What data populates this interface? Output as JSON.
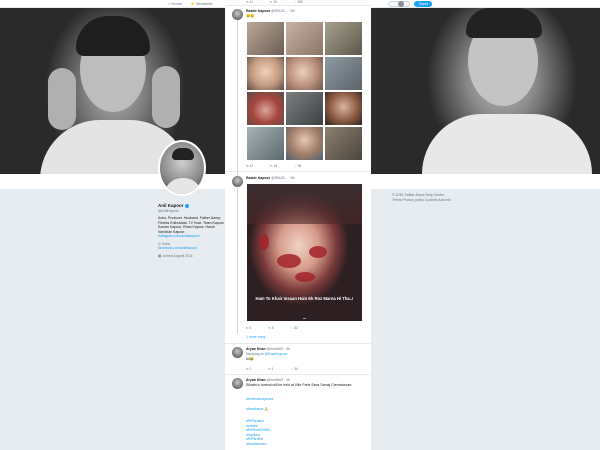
{
  "nav": {
    "home": "⌂ Home",
    "moments": "⚡ Moments",
    "tweet_button": "Tweet"
  },
  "profile": {
    "name": "Anil Kapoor",
    "handle": "@AnilKapoor",
    "bio": "Actor, Producer, Husband, Father &amp; Fitness Enthusiast. TV Host. Team Kapoor. Sonam Kapoor, Rhea Kapoor, Harsh Varrdhan Kapoor.",
    "links": [
      "instagram.com/anilskapoor",
      "facebook.com/anilkapoor"
    ],
    "location": "India",
    "joined": "Joined August 2011"
  },
  "footer": {
    "text": "© 2018 Twitter  About  Help Center  Terms  Privacy policy  Cookies  Ads info"
  },
  "tweets": [
    {
      "name": "Rasbir Kapoor",
      "handle": "@IRAJB...",
      "time": "5h",
      "text": "😢😢",
      "actions_top": {
        "reply": "11",
        "retweet": "15",
        "like": "389"
      },
      "actions": {
        "reply": "12",
        "retweet": "15",
        "like": "96"
      }
    },
    {
      "name": "Rasbir Kapoor",
      "handle": "@IRAJB...",
      "time": "5h",
      "image_caption": "Ham To Khair Insaan Hain Ek Roz Marna Hi Tha..!",
      "image_caption_cut": "...",
      "actions": {
        "reply": "4",
        "retweet": "5",
        "like": "52"
      },
      "reply_link": "1 more reply"
    },
    {
      "name": "Aryan Khan",
      "handle": "@nnnth63",
      "time": "4h",
      "replying_to": "Replying to",
      "replying_handle": "@RasbKapoor",
      "text": "lol😂",
      "actions": {
        "reply": "1",
        "retweet": "1",
        "like": "34"
      }
    },
    {
      "name": "Aryan Khan",
      "handle": "@nnnth63",
      "time": "4h",
      "text": "Slkaleo's funeral will be held  at Ville Parle Seva Samaj Crematorium",
      "hashtags": [
        "#forbeckinapeace",
        "#beatthaus",
        "#RIPsridevi",
        "#sridevi",
        "#RIPAmitZiddik",
        "#mydocs",
        "#RIPsrdevi",
        "#heartbroken"
      ]
    }
  ],
  "colors": {
    "accent": "#1da1f2",
    "text_primary": "#14171a",
    "text_secondary": "#657786",
    "canvas": "#e6ecf0"
  }
}
